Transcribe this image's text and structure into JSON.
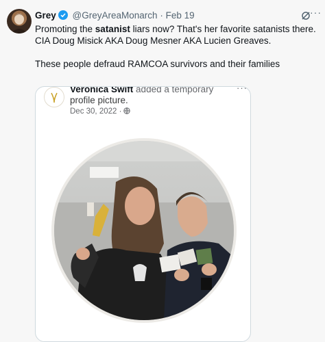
{
  "tweet": {
    "author_name": "Grey",
    "handle": "@GreyAreaMonarch",
    "separator": "·",
    "date": "Feb 19",
    "more_label": "···",
    "text_pre": "Promoting the ",
    "text_bold": "satanist",
    "text_post": " liars now? That's her favorite satanists there. CIA Doug Misick AKA Doug Mesner AKA Lucien Greaves.",
    "text_para2": "These people defraud RAMCOA survivors and their families"
  },
  "embedded_post": {
    "author": "Veronica Swift",
    "action": "added a temporary",
    "action_line2": "profile picture.",
    "date": "Dec 30, 2022",
    "separator": "·",
    "more_label": "···"
  },
  "colors": {
    "verified": "#1d9bf0",
    "secondary_text": "#536471",
    "card_border": "#cfd9de"
  },
  "icons": [
    "verified-badge-icon",
    "grok-icon",
    "globe-icon",
    "more-icon"
  ]
}
